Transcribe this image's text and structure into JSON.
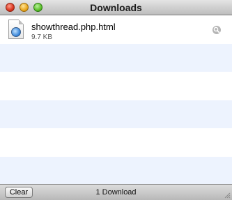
{
  "window": {
    "title": "Downloads"
  },
  "downloads": [
    {
      "name": "showthread.php.html",
      "size": "9.7 KB",
      "icon": "html-document-icon",
      "action_icon": "magnifier-icon"
    }
  ],
  "footer": {
    "clear_label": "Clear",
    "count_text": "1 Download"
  },
  "colors": {
    "row_alt": "#edf3fe",
    "close": "#d9361f",
    "minimize": "#e9a71d",
    "zoom": "#5cbf2a"
  }
}
